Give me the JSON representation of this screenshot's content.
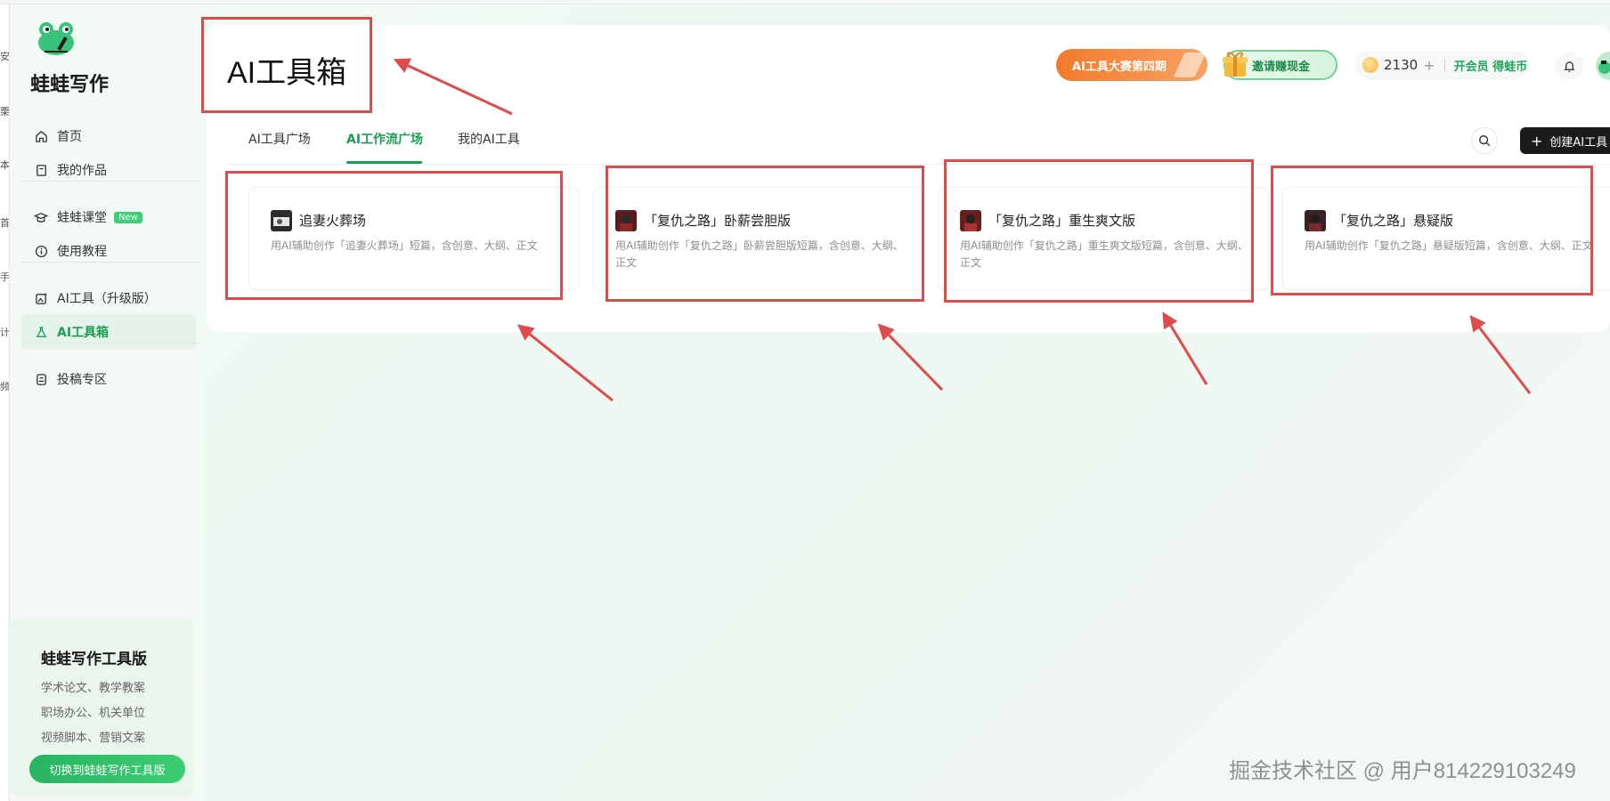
{
  "edge_strip": {
    "chars": [
      "安",
      "栗",
      "本",
      "首",
      "手",
      "计",
      "频"
    ]
  },
  "sidebar": {
    "brand": "蛙蛙写作",
    "nav": {
      "home": "首页",
      "works": "我的作品",
      "course": "蛙蛙课堂",
      "course_badge": "New",
      "tutorial": "使用教程",
      "ai_tools_upgrade": "AI工具（升级版）",
      "ai_toolbox": "AI工具箱",
      "submission": "投稿专区"
    },
    "promo": {
      "title": "蛙蛙写作工具版",
      "lines": [
        "学术论文、教学教案",
        "职场办公、机关单位",
        "视频脚本、营销文案"
      ],
      "button": "切换到蛙蛙写作工具版"
    }
  },
  "header": {
    "title": "AI工具箱",
    "contest": "AI工具大赛第四期",
    "invite": "邀请赚现金",
    "coins": "2130",
    "coins_plus": "+",
    "vip": "开会员 得蛙币"
  },
  "tabs": [
    {
      "label": "AI工具广场",
      "active": false
    },
    {
      "label": "AI工作流广场",
      "active": true
    },
    {
      "label": "我的AI工具",
      "active": false
    }
  ],
  "create_button": "创建AI工具",
  "tools": [
    {
      "name": "追妻火葬场",
      "desc": "用AI辅助创作「追妻火葬场」短篇，含创意、大纲、正文"
    },
    {
      "name": "「复仇之路」卧薪尝胆版",
      "desc": "用AI辅助创作「复仇之路」卧薪尝胆版短篇，含创意、大纲、正文"
    },
    {
      "name": "「复仇之路」重生爽文版",
      "desc": "用AI辅助创作「复仇之路」重生爽文版短篇，含创意、大纲、正文"
    },
    {
      "name": "「复仇之路」悬疑版",
      "desc": "用AI辅助创作「复仇之路」悬疑版短篇，含创意、大纲、正文"
    }
  ],
  "watermark": "掘金技术社区 @ 用户814229103249",
  "colors": {
    "accent": "#1a9e55",
    "annotation": "#e04a4a",
    "contest": "#f47a2c"
  }
}
